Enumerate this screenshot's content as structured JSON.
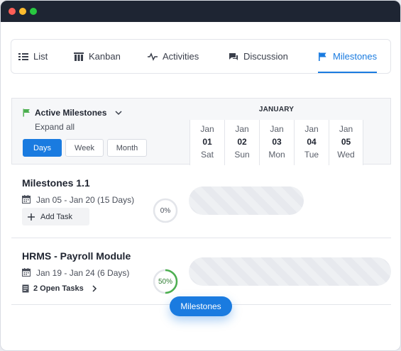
{
  "tabs": [
    {
      "label": "List",
      "icon": "list-icon"
    },
    {
      "label": "Kanban",
      "icon": "kanban-icon"
    },
    {
      "label": "Activities",
      "icon": "activity-icon"
    },
    {
      "label": "Discussion",
      "icon": "chat-icon"
    },
    {
      "label": "Milestones",
      "icon": "flag-icon",
      "active": true
    }
  ],
  "header": {
    "title": "Active Milestones",
    "expand_all": "Expand all",
    "views": [
      "Days",
      "Week",
      "Month"
    ],
    "active_view": "Days",
    "month": "JANUARY",
    "days": [
      {
        "month": "Jan",
        "num": "01",
        "weekday": "Sat"
      },
      {
        "month": "Jan",
        "num": "02",
        "weekday": "Sun"
      },
      {
        "month": "Jan",
        "num": "03",
        "weekday": "Mon"
      },
      {
        "month": "Jan",
        "num": "04",
        "weekday": "Tue"
      },
      {
        "month": "Jan",
        "num": "05",
        "weekday": "Wed"
      }
    ]
  },
  "milestones": [
    {
      "title": "Milestones 1.1",
      "dates": "Jan 05 - Jan 20 (15 Days)",
      "progress_label": "0%",
      "progress": 0,
      "action": "Add Task"
    },
    {
      "title": "HRMS - Payroll Module",
      "dates": "Jan 19 - Jan 24 (6 Days)",
      "progress_label": "50%",
      "progress": 0.5,
      "action": "2 Open Tasks"
    }
  ],
  "floating_label": "Milestones",
  "colors": {
    "accent": "#1a7be0",
    "progress_green": "#4caf50",
    "titlebar": "#1e2533"
  }
}
